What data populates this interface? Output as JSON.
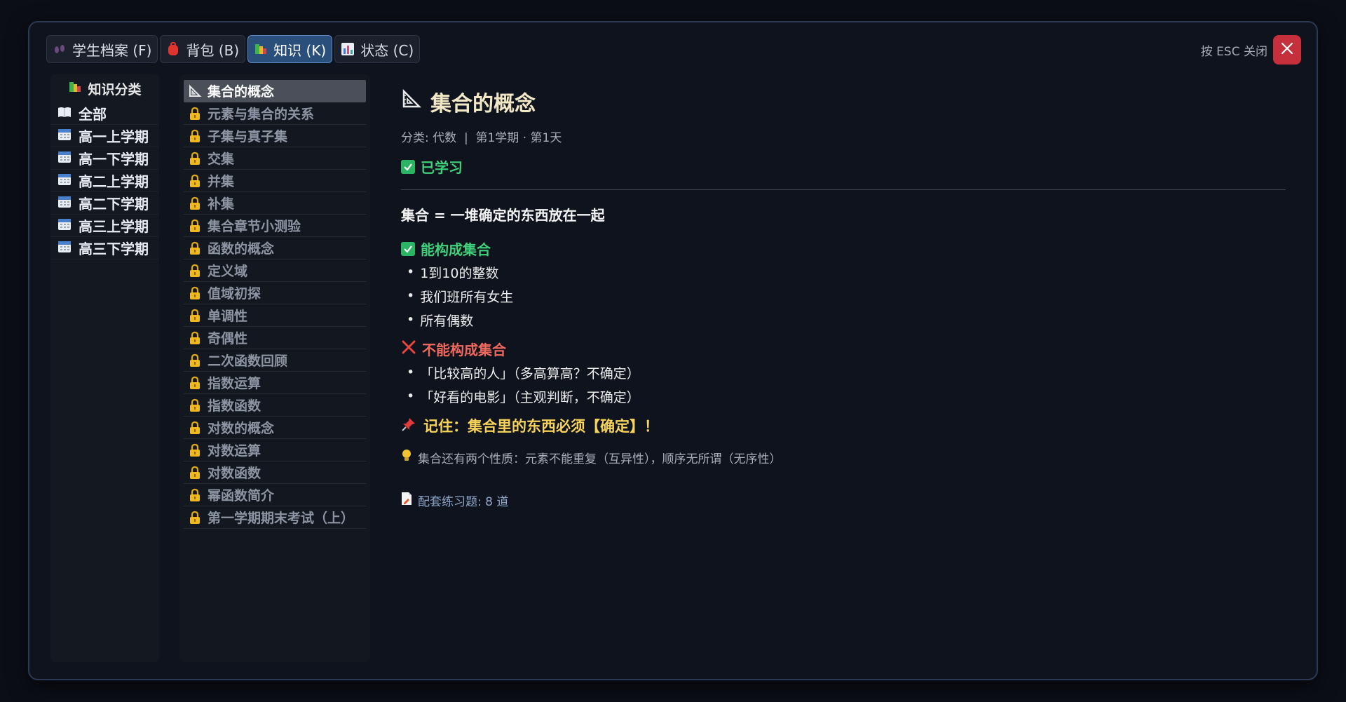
{
  "tabs": [
    {
      "label": "学生档案 (F)",
      "icon": "footprints-icon",
      "active": false
    },
    {
      "label": "背包 (B)",
      "icon": "backpack-icon",
      "active": false
    },
    {
      "label": "知识 (K)",
      "icon": "books-icon",
      "active": true
    },
    {
      "label": "状态 (C)",
      "icon": "bar-chart-icon",
      "active": false
    }
  ],
  "close": {
    "hint": "按 ESC 关闭",
    "icon": "close-icon"
  },
  "categories": {
    "title": "知识分类",
    "items": [
      {
        "label": "全部",
        "icon": "book-icon"
      },
      {
        "label": "高一上学期",
        "icon": "calendar-icon"
      },
      {
        "label": "高一下学期",
        "icon": "calendar-icon"
      },
      {
        "label": "高二上学期",
        "icon": "calendar-icon"
      },
      {
        "label": "高二下学期",
        "icon": "calendar-icon"
      },
      {
        "label": "高三上学期",
        "icon": "calendar-icon"
      },
      {
        "label": "高三下学期",
        "icon": "calendar-icon"
      }
    ]
  },
  "topics": [
    {
      "label": "集合的概念",
      "icon": "triangle-ruler-icon",
      "active": true
    },
    {
      "label": "元素与集合的关系",
      "icon": "lock-icon"
    },
    {
      "label": "子集与真子集",
      "icon": "lock-icon"
    },
    {
      "label": "交集",
      "icon": "lock-icon"
    },
    {
      "label": "并集",
      "icon": "lock-icon"
    },
    {
      "label": "补集",
      "icon": "lock-icon"
    },
    {
      "label": "集合章节小测验",
      "icon": "lock-icon"
    },
    {
      "label": "函数的概念",
      "icon": "lock-icon"
    },
    {
      "label": "定义域",
      "icon": "lock-icon"
    },
    {
      "label": "值域初探",
      "icon": "lock-icon"
    },
    {
      "label": "单调性",
      "icon": "lock-icon"
    },
    {
      "label": "奇偶性",
      "icon": "lock-icon"
    },
    {
      "label": "二次函数回顾",
      "icon": "lock-icon"
    },
    {
      "label": "指数运算",
      "icon": "lock-icon"
    },
    {
      "label": "指数函数",
      "icon": "lock-icon"
    },
    {
      "label": "对数的概念",
      "icon": "lock-icon"
    },
    {
      "label": "对数运算",
      "icon": "lock-icon"
    },
    {
      "label": "对数函数",
      "icon": "lock-icon"
    },
    {
      "label": "幂函数简介",
      "icon": "lock-icon"
    },
    {
      "label": "第一学期期末考试（上）",
      "icon": "lock-icon"
    }
  ],
  "detail": {
    "title": "集合的概念",
    "meta": "分类: 代数  |  第1学期 · 第1天",
    "status": "已学习",
    "definition": "集合 = 一堆确定的东西放在一起",
    "can_title": "能构成集合",
    "can_items": [
      "1到10的整数",
      "我们班所有女生",
      "所有偶数"
    ],
    "cannot_title": "不能构成集合",
    "cannot_items": [
      "「比较高的人」（多高算高？不确定）",
      "「好看的电影」（主观判断，不确定）"
    ],
    "remember": "记住：集合里的东西必须【确定】！",
    "tip": "集合还有两个性质：元素不能重复（互异性），顺序无所谓（无序性）",
    "exercise": "配套练习题: 8 道"
  },
  "colors": {
    "accent_tab": "#2a4f7a",
    "success": "#3ed07a",
    "danger": "#f0695f",
    "highlight": "#f7d35a",
    "close": "#c62f3c"
  }
}
